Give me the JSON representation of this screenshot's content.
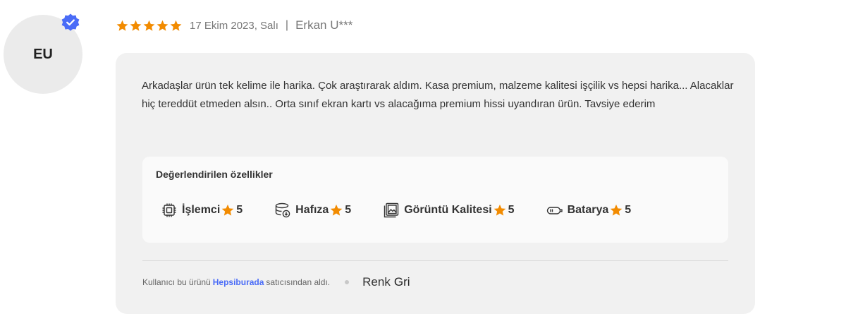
{
  "avatar": {
    "initials": "EU"
  },
  "review": {
    "rating": 5,
    "rating_max": 5,
    "date": "17 Ekim 2023, Salı",
    "separator": "|",
    "author": "Erkan U***",
    "text": "Arkadaşlar ürün tek kelime ile harika. Çok araştırarak aldım. Kasa premium, malzeme kalitesi işçilik vs hepsi harika... Alacaklar hiç tereddüt etmeden alsın.. Orta sınıf ekran kartı vs alacağıma premium hissi uyandıran ürün. Tavsiye ederim"
  },
  "features": {
    "title": "Değerlendirilen özellikler",
    "items": [
      {
        "label": "İşlemci",
        "score": "5",
        "icon": "processor-icon"
      },
      {
        "label": "Hafıza",
        "score": "5",
        "icon": "memory-icon"
      },
      {
        "label": "Görüntü Kalitesi",
        "score": "5",
        "icon": "image-quality-icon"
      },
      {
        "label": "Batarya",
        "score": "5",
        "icon": "battery-icon"
      }
    ]
  },
  "footer": {
    "seller_pre": "Kullanıcı bu ürünü",
    "seller_name": "Hepsiburada",
    "seller_post": "satıcısından aldı.",
    "attr_label": "Renk",
    "attr_value": "Gri"
  },
  "colors": {
    "star": "#f28b00",
    "verified": "#4a6cf7",
    "link": "#4a6cf7",
    "card_bg": "#f1f1f1"
  }
}
